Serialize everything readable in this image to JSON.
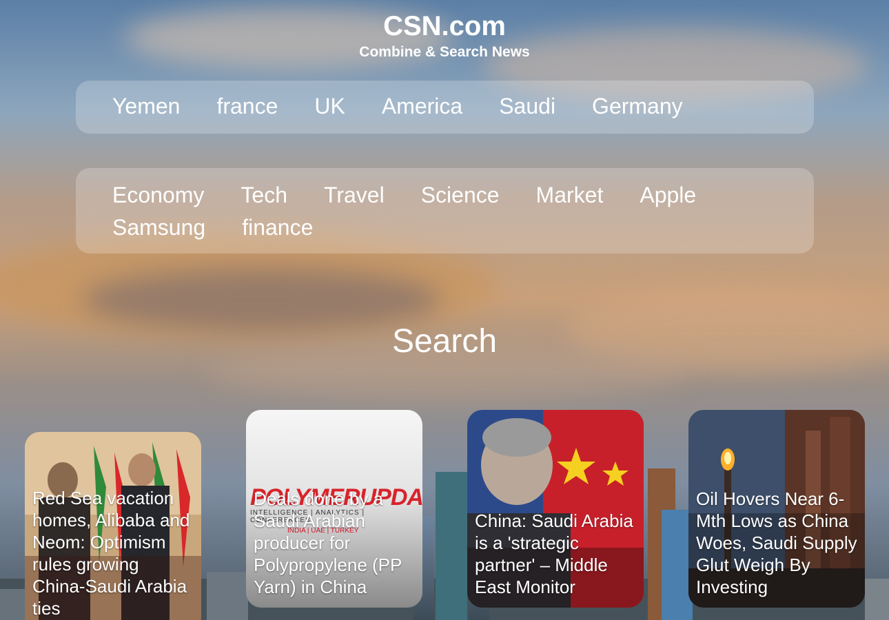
{
  "header": {
    "title": "CSN.com",
    "tagline": "Combine & Search News"
  },
  "countries": [
    "Yemen",
    "france",
    "UK",
    "America",
    "Saudi",
    "Germany"
  ],
  "topics": [
    "Economy",
    "Tech",
    "Travel",
    "Science",
    "Market",
    "Apple",
    "Samsung",
    "finance"
  ],
  "search": {
    "label": "Search"
  },
  "cards": [
    {
      "title": "Red Sea vacation homes, Alibaba and Neom: Optimism rules growing China-Saudi Arabia ties"
    },
    {
      "title": "Deals done by a Saudi Arabian producer for Polypropylene (PP Yarn) in China",
      "logo": "POLYMERUPDATE",
      "logo_sub": "INTELLIGENCE | ANALYTICS | CONFERENCES",
      "logo_sub2": "INDIA | UAE | TURKEY"
    },
    {
      "title": "China: Saudi Arabia is a 'strategic partner' – Middle East Monitor"
    },
    {
      "title": "Oil Hovers Near 6-Mth Lows as China Woes, Saudi Supply Glut Weigh By Investing"
    }
  ],
  "colors": {
    "panel": "rgba(255,255,255,0.22)",
    "text": "#ffffff",
    "logo_red": "#d8232a"
  }
}
